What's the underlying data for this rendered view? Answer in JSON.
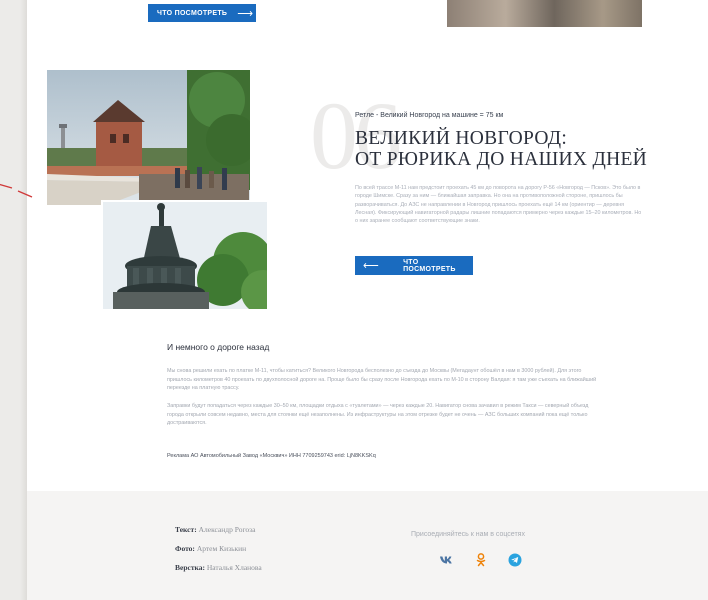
{
  "top_button": {
    "label": "что посмотреть",
    "arrow": "⟶"
  },
  "section": {
    "number": "06",
    "route": "Ретле - Великий Новгород на машине = 75 км",
    "title_line1": "ВЕЛИКИЙ НОВГОРОД:",
    "title_line2": "ОТ РЮРИКА ДО НАШИХ ДНЕЙ",
    "description": "По всей трассе М-11 нам предстоит проехать 45 км до поворота на дорогу Р-56 «Новгород — Псков». Это было в городе Шимске. Сразу за ним — ближайшая заправка. Но она на противоположной стороне, пришлось бы разворачиваться. До АЗС не направлении в Новгород пришлось проехать ещё 14 км (ориентир — деревня Лесная). Фиксирующий навигаторной радары лишние попадаются примерно через каждые 15–20 километров. Но о них заранее сообщают соответствующие знаки.",
    "button": {
      "label": "что посмотреть",
      "arrow": "⟵"
    }
  },
  "road_back": {
    "heading": "И немного о дороге назад",
    "paragraph1": "Мы снова решили ехать по платке М-11, чтобы катиться? Великого Новгорода бесполезно до съезда до Москвы (Мегадаунт обошёл в нам в 3000 рублей). Для этого пришлось километров 40 проехать по двухполосной дороге на. Проще было бы сразу после Новгорода ехать по М-10 в сторону Валдая: я там уже съехать на ближайший переезде на платную трассу.",
    "paragraph2": "Заправки будут попадаться через каждые 30–50 км, площадки отдыха с «туалетами» — через каждые 20. Навигатор снова зачавил в режим Такси — северный объезд города открыли совсем недавно, места для стоянки ещё незаполнены. Из инфраструктуры на этом отрезке будет не очень — АЗС больших компаний пока ещё только достраиваются."
  },
  "ad_text": "Реклама АО Автомобильный Завод «Москвич» ИНН 7709259743 erid: LjN8KKSKq",
  "footer": {
    "credits": [
      {
        "role": "Текст:",
        "name": "Александр Рогоза"
      },
      {
        "role": "Фото:",
        "name": "Артем Кизькин"
      },
      {
        "role": "Верстка:",
        "name": "Наталья Хланова"
      }
    ],
    "join_text": "Присоединяйтесь к нам в соцсетях",
    "social": [
      {
        "name": "vk",
        "glyph": "VK",
        "color": "#4c75a3"
      },
      {
        "name": "odnoklassniki",
        "glyph": "ok",
        "color": "#ee8208"
      },
      {
        "name": "telegram",
        "glyph": "tg",
        "color": "#2aa3df"
      }
    ]
  },
  "colors": {
    "accent": "#1a6bbf",
    "annotation": "#d03a3a"
  }
}
